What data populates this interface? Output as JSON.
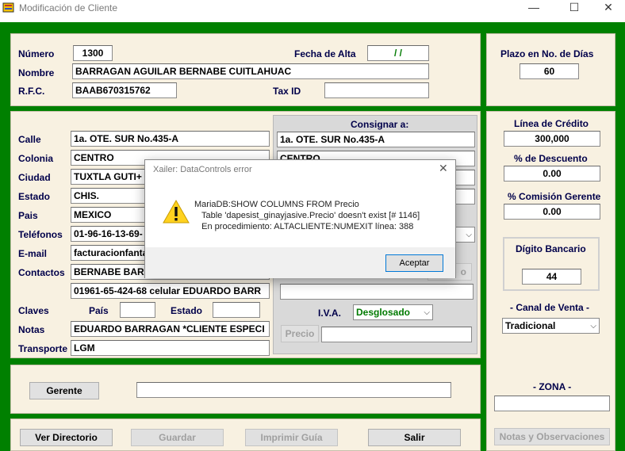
{
  "window": {
    "title": "Modificación de Cliente",
    "minimize": "—",
    "maximize": "☐",
    "close": "✕"
  },
  "header": {
    "numero_label": "Número",
    "numero_value": "1300",
    "fecha_alta_label": "Fecha de Alta",
    "fecha_alta_value": "/ /",
    "nombre_label": "Nombre",
    "nombre_value": "BARRAGAN AGUILAR BERNABE CUITLAHUAC",
    "rfc_label": "R.F.C.",
    "rfc_value": "BAAB670315762",
    "taxid_label": "Tax ID",
    "taxid_value": ""
  },
  "plazo": {
    "label": "Plazo en No. de Días",
    "value": "60"
  },
  "address": {
    "calle_label": "Calle",
    "calle_value": "1a. OTE. SUR No.435-A",
    "colonia_label": "Colonia",
    "colonia_value": "CENTRO",
    "ciudad_label": "Ciudad",
    "ciudad_value": "TUXTLA GUTI+",
    "estado_label": "Estado",
    "estado_value": "CHIS.",
    "pais_label": "Pais",
    "pais_value": "MEXICO",
    "telefonos_label": "Teléfonos",
    "telefonos_value": "01-96-16-13-69-",
    "email_label": "E-mail",
    "email_value": "facturacionfanta",
    "contactos_label": "Contactos",
    "contactos_value": "BERNABE BARR",
    "contactos_value2": "01961-65-424-68  celular EDUARDO BARR",
    "claves_label": "Claves",
    "pais2_label": "País",
    "pais2_value": "",
    "estado2_label": "Estado",
    "estado2_value": "",
    "notas_label": "Notas",
    "notas_value": "EDUARDO BARRAGAN *CLIENTE ESPECI",
    "transporte_label": "Transporte",
    "transporte_value": "LGM"
  },
  "consignar": {
    "label": "Consignar a:",
    "calle_value": "1a. OTE. SUR No.435-A",
    "colonia_value": "CENTRO",
    "btn_partial": "o",
    "iva_label": "I.V.A.",
    "iva_value": "Desglosado",
    "precio_label": "Precio",
    "precio_value": ""
  },
  "credito": {
    "linea_label": "Línea de Crédito",
    "linea_value": "300,000",
    "descuento_label": "% de Descuento",
    "descuento_value": "0.00",
    "comision_label": "% Comisión Gerente",
    "comision_value": "0.00",
    "digito_label": "Dígito Bancario",
    "digito_value": "44",
    "canal_label": "- Canal de Venta -",
    "canal_value": "Tradicional",
    "zona_label": "- ZONA -",
    "zona_value": ""
  },
  "gerente": {
    "button": "Gerente",
    "value": ""
  },
  "actions": {
    "ver_directorio": "Ver Directorio",
    "guardar": "Guardar",
    "imprimir_guia": "Imprimir Guía",
    "salir": "Salir",
    "notas_obs": "Notas y Observaciones"
  },
  "dialog": {
    "title": "Xailer: DataControls error",
    "close": "✕",
    "line1": "MariaDB:SHOW COLUMNS FROM Precio",
    "line2": "   Table 'dapesist_ginayjasive.Precio' doesn't exist [# 1146]",
    "line3": "   En procedimiento: ALTACLIENTE:NUMEXIT línea: 388",
    "ok": "Aceptar"
  },
  "colors": {
    "background": "#008000",
    "panel": "#f8f1e1",
    "label_navy": "#00004a",
    "iva_green": "#007a00"
  }
}
